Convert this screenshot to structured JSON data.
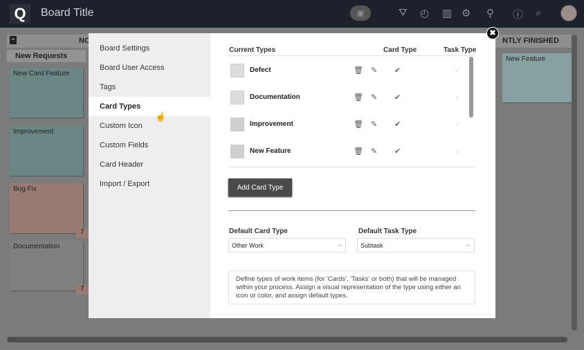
{
  "header": {
    "title": "Board Title",
    "icons": [
      "logo",
      "board-settings-icon",
      "filter-icon",
      "timeline-icon",
      "chart-icon",
      "gear-icon",
      "add-user-icon",
      "info-icon",
      "search-icon",
      "avatar"
    ]
  },
  "board": {
    "lane_left": "NO",
    "lane_right": "NTLY FINISHED",
    "column": "New Requests",
    "cards": [
      {
        "title": "New Card Feature",
        "color": "#6a8785"
      },
      {
        "title": "Improvement",
        "color": "#6a8785"
      },
      {
        "title": "Bug Fix",
        "color": "#9a7b73"
      },
      {
        "title": "Documentation",
        "color": "#808080"
      }
    ],
    "right_card": {
      "title": "New Feature",
      "color": "#86a19f"
    },
    "date_badge": "7"
  },
  "modal": {
    "nav": [
      {
        "label": "Board Settings"
      },
      {
        "label": "Board User Access"
      },
      {
        "label": "Tags"
      },
      {
        "label": "Card Types",
        "active": true
      },
      {
        "label": "Custom Icon"
      },
      {
        "label": "Custom Fields"
      },
      {
        "label": "Card Header"
      },
      {
        "label": "Import / Export"
      }
    ],
    "table": {
      "headers": {
        "name": "Current Types",
        "card": "Card Type",
        "task": "Task Type"
      },
      "rows": [
        {
          "name": "Defect",
          "card_type": true,
          "task_type": false
        },
        {
          "name": "Documentation",
          "card_type": true,
          "task_type": false
        },
        {
          "name": "Improvement",
          "card_type": true,
          "task_type": false
        },
        {
          "name": "New Feature",
          "card_type": true,
          "task_type": false
        }
      ]
    },
    "add_button": "Add Card Type",
    "default_card": {
      "label": "Default Card Type",
      "value": "Other Work"
    },
    "default_task": {
      "label": "Default Task Type",
      "value": "Subtask"
    },
    "description": "Define types of work items (for 'Cards', 'Tasks' or both) that will be managed within your process. Assign a visual representation of the type using either an icon or color, and assign default types."
  }
}
